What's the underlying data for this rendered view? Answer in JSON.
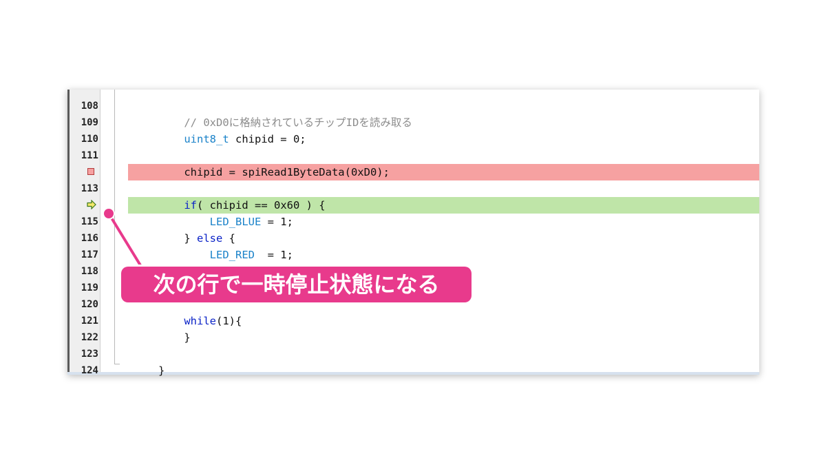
{
  "editor": {
    "lines": [
      {
        "number": "108",
        "tokens": []
      },
      {
        "number": "109",
        "tokens": [
          {
            "text": "    // 0xD0に格納されているチップIDを読み取る",
            "kind": "comment"
          }
        ]
      },
      {
        "number": "110",
        "tokens": [
          {
            "text": "    ",
            "kind": "plain"
          },
          {
            "text": "uint8_t",
            "kind": "type"
          },
          {
            "text": " chipid = 0;",
            "kind": "plain"
          }
        ]
      },
      {
        "number": "111",
        "tokens": []
      },
      {
        "number": "",
        "marker": "breakpoint",
        "tokens": [
          {
            "text": "    chipid = spiRead1ByteData(0xD0);",
            "kind": "plain"
          }
        ]
      },
      {
        "number": "113",
        "tokens": []
      },
      {
        "number": "",
        "marker": "current",
        "tokens": [
          {
            "text": "    ",
            "kind": "plain"
          },
          {
            "text": "if",
            "kind": "kw"
          },
          {
            "text": "( chipid == 0x60 ) {",
            "kind": "plain"
          }
        ]
      },
      {
        "number": "115",
        "tokens": [
          {
            "text": "        ",
            "kind": "plain"
          },
          {
            "text": "LED_BLUE",
            "kind": "mac"
          },
          {
            "text": " = 1;",
            "kind": "plain"
          }
        ]
      },
      {
        "number": "116",
        "tokens": [
          {
            "text": "    } ",
            "kind": "plain"
          },
          {
            "text": "else",
            "kind": "kw"
          },
          {
            "text": " {",
            "kind": "plain"
          }
        ]
      },
      {
        "number": "117",
        "tokens": [
          {
            "text": "        ",
            "kind": "plain"
          },
          {
            "text": "LED_RED",
            "kind": "mac"
          },
          {
            "text": "  = 1;",
            "kind": "plain"
          }
        ]
      },
      {
        "number": "118",
        "tokens": [
          {
            "text": "    }",
            "kind": "plain"
          }
        ]
      },
      {
        "number": "119",
        "tokens": []
      },
      {
        "number": "120",
        "tokens": []
      },
      {
        "number": "121",
        "tokens": [
          {
            "text": "    ",
            "kind": "plain"
          },
          {
            "text": "while",
            "kind": "kw"
          },
          {
            "text": "(1){",
            "kind": "plain"
          }
        ]
      },
      {
        "number": "122",
        "tokens": [
          {
            "text": "    }",
            "kind": "plain"
          }
        ]
      },
      {
        "number": "123",
        "tokens": []
      },
      {
        "number": "124",
        "tokens": [
          {
            "text": "}",
            "kind": "plain"
          }
        ]
      }
    ],
    "colors": {
      "breakpoint_line": "#f6a1a1",
      "current_line": "#bfe5a8",
      "keyword": "#0a22c7",
      "type": "#1a82c9",
      "comment": "#8c8c8c"
    }
  },
  "callout": {
    "text": "次の行で一時停止状態になる",
    "color": "#e83a8c"
  },
  "icons": {
    "breakpoint": "breakpoint-icon",
    "current": "current-line-arrow-icon"
  }
}
